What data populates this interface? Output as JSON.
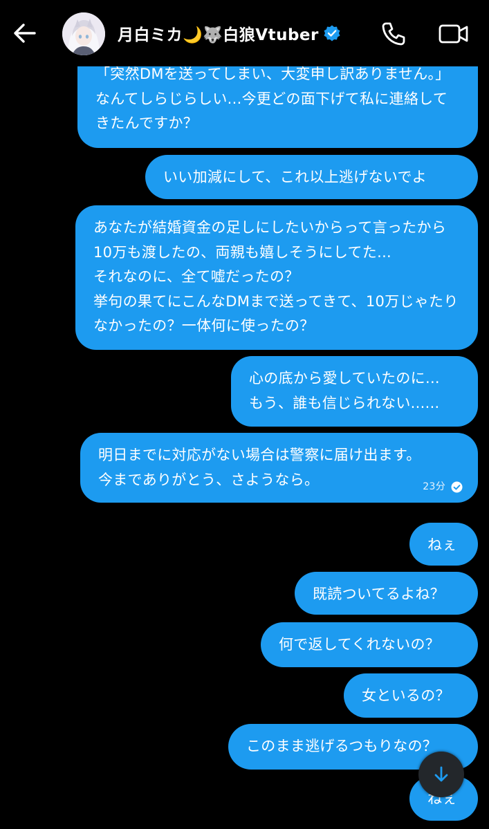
{
  "header": {
    "title": "月白ミカ🌙🐺白狼Vtuber",
    "avatar_alt": "profile avatar"
  },
  "messages": [
    {
      "text": "「突然DMを送ってしまい、大変申し訳ありません。」なんてしらじらしい...今更どの面下げて私に連絡してきたんですか？"
    },
    {
      "text": "いい加減にして、これ以上逃げないでよ"
    },
    {
      "text": "あなたが結婚資金の足しにしたいからって言ったから10万も渡したの、両親も嬉しそうにしてた...\nそれなのに、全て嘘だったの？\n挙句の果てにこんなDMまで送ってきて、10万じゃたりなかったの？一体何に使ったの？"
    },
    {
      "text": "心の底から愛していたのに...\nもう、誰も信じられない......"
    },
    {
      "text": "明日までに対応がない場合は警察に届け出ます。\n今までありがとう、さようなら。",
      "time": "23分",
      "status": "read"
    },
    {
      "text": "ねぇ"
    },
    {
      "text": "既読ついてるよね？"
    },
    {
      "text": "何で返してくれないの？"
    },
    {
      "text": "女といるの？"
    },
    {
      "text": "このまま逃げるつもりなの？"
    },
    {
      "text": "ねぇ"
    }
  ],
  "colors": {
    "bubble": "#1d9bf0",
    "background": "#000000",
    "verified": "#1d9bf0"
  },
  "icons": [
    "back-arrow-icon",
    "verified-badge-icon",
    "phone-icon",
    "video-camera-icon",
    "arrow-down-icon",
    "read-check-icon"
  ]
}
